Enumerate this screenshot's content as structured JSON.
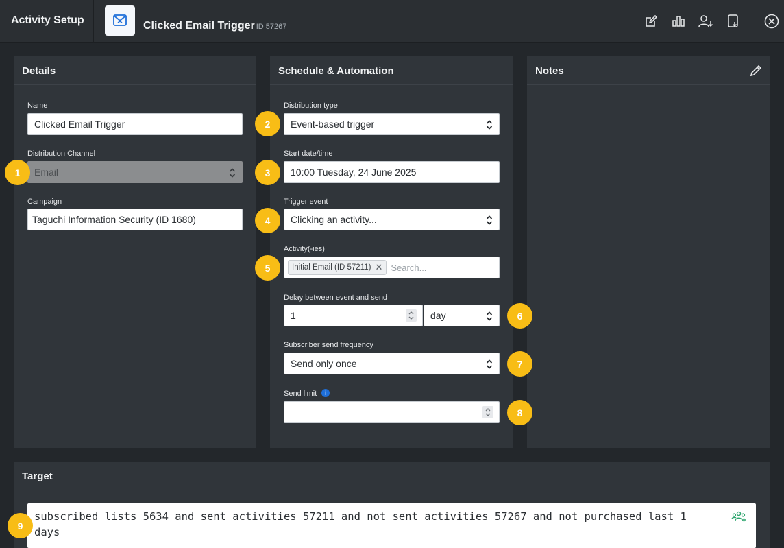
{
  "header": {
    "app_title": "Activity Setup",
    "activity_name": "Clicked Email Trigger",
    "activity_id": "ID 57267",
    "tools": [
      "edit-icon",
      "stats-icon",
      "user-download-icon",
      "document-download-icon",
      "close-icon"
    ]
  },
  "details": {
    "title": "Details",
    "name_label": "Name",
    "name_value": "Clicked Email Trigger",
    "channel_label": "Distribution Channel",
    "channel_value": "Email",
    "campaign_label": "Campaign",
    "campaign_value": "Taguchi Information Security (ID 1680)"
  },
  "schedule": {
    "title": "Schedule & Automation",
    "distribution_type_label": "Distribution type",
    "distribution_type_value": "Event-based trigger",
    "start_label": "Start date/time",
    "start_value": "10:00 Tuesday, 24 June 2025",
    "trigger_label": "Trigger event",
    "trigger_value": "Clicking an activity...",
    "activities_label": "Activity(-ies)",
    "activity_chip": "Initial Email (ID 57211)",
    "activities_placeholder": "Search...",
    "delay_label": "Delay between event and send",
    "delay_value": "1",
    "delay_unit": "day",
    "frequency_label": "Subscriber send frequency",
    "frequency_value": "Send only once",
    "send_limit_label": "Send limit",
    "send_limit_value": ""
  },
  "notes": {
    "title": "Notes"
  },
  "target": {
    "title": "Target",
    "expression": "subscribed lists 5634 and sent activities 57211 and not sent activities 57267 and not purchased last 1 days"
  },
  "badges": [
    "1",
    "2",
    "3",
    "4",
    "5",
    "6",
    "7",
    "8",
    "9"
  ],
  "colors": {
    "badge": "#f8bd16",
    "panel": "#30353a",
    "background": "#23272b",
    "accent": "#1e6fd9"
  }
}
